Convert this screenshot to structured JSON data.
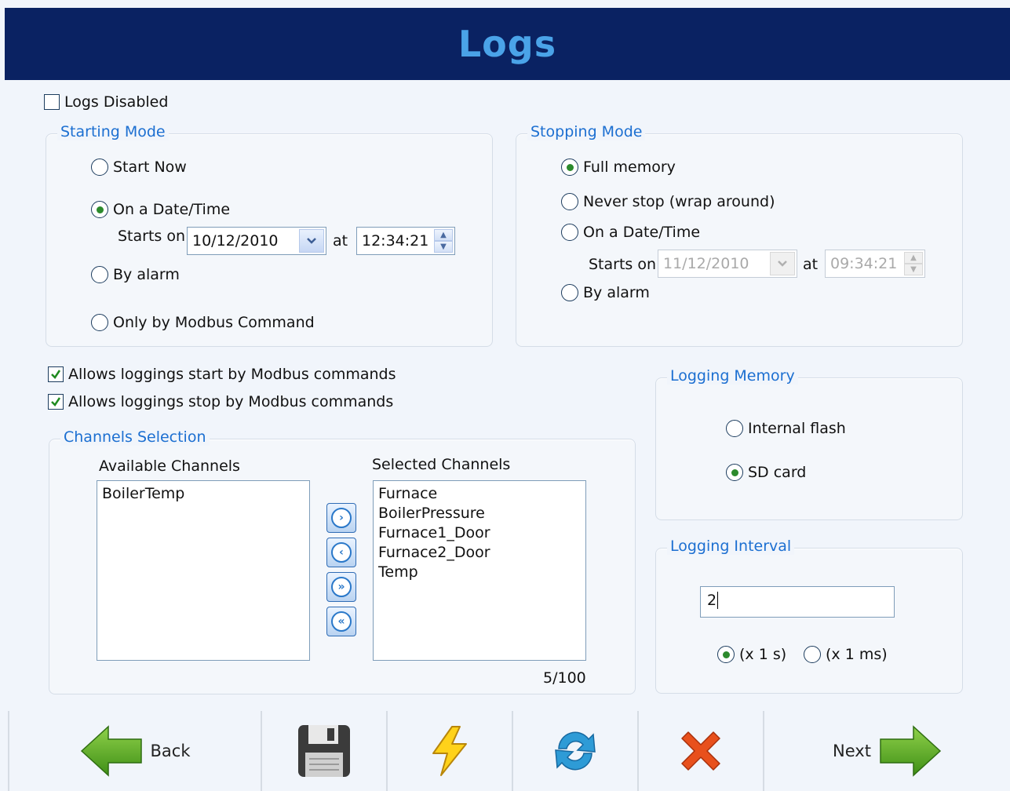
{
  "header": {
    "title": "Logs"
  },
  "logs_disabled": {
    "label": "Logs Disabled",
    "checked": false
  },
  "starting_mode": {
    "legend": "Starting Mode",
    "options": [
      "Start Now",
      "On a Date/Time",
      "By alarm",
      "Only by Modbus Command"
    ],
    "selected": "On a Date/Time",
    "starts_on_label": "Starts on",
    "date": "10/12/2010",
    "at_label": "at",
    "time": "12:34:21"
  },
  "stopping_mode": {
    "legend": "Stopping Mode",
    "options": [
      "Full memory",
      "Never stop (wrap around)",
      "On a Date/Time",
      "By alarm"
    ],
    "selected": "Full memory",
    "starts_on_label": "Starts on",
    "date": "11/12/2010",
    "at_label": "at",
    "time": "09:34:21"
  },
  "modbus": {
    "allow_start": {
      "label": "Allows loggings start by Modbus commands",
      "checked": true
    },
    "allow_stop": {
      "label": "Allows loggings stop by Modbus commands",
      "checked": true
    }
  },
  "channels": {
    "legend": "Channels Selection",
    "available_label": "Available Channels",
    "available": [
      "BoilerTemp"
    ],
    "selected_label": "Selected Channels",
    "selected": [
      "Furnace",
      "BoilerPressure",
      "Furnace1_Door",
      "Furnace2_Door",
      "Temp"
    ],
    "count": "5/100"
  },
  "logging_memory": {
    "legend": "Logging Memory",
    "options": [
      "Internal flash",
      "SD card"
    ],
    "selected": "SD card"
  },
  "logging_interval": {
    "legend": "Logging Interval",
    "value": "2",
    "unit_options": [
      "(x 1 s)",
      "(x 1 ms)"
    ],
    "selected_unit": "(x 1 s)"
  },
  "toolbar": {
    "back_label": "Back",
    "next_label": "Next",
    "icons": [
      "back-arrow-icon",
      "save-disk-icon",
      "lightning-icon",
      "refresh-icon",
      "cancel-x-icon",
      "next-arrow-icon"
    ]
  },
  "colors": {
    "header_bg": "#0a2262",
    "header_text": "#4aa3e8",
    "legend_text": "#1c6fd1",
    "radio_dot": "#2c8a2c"
  }
}
